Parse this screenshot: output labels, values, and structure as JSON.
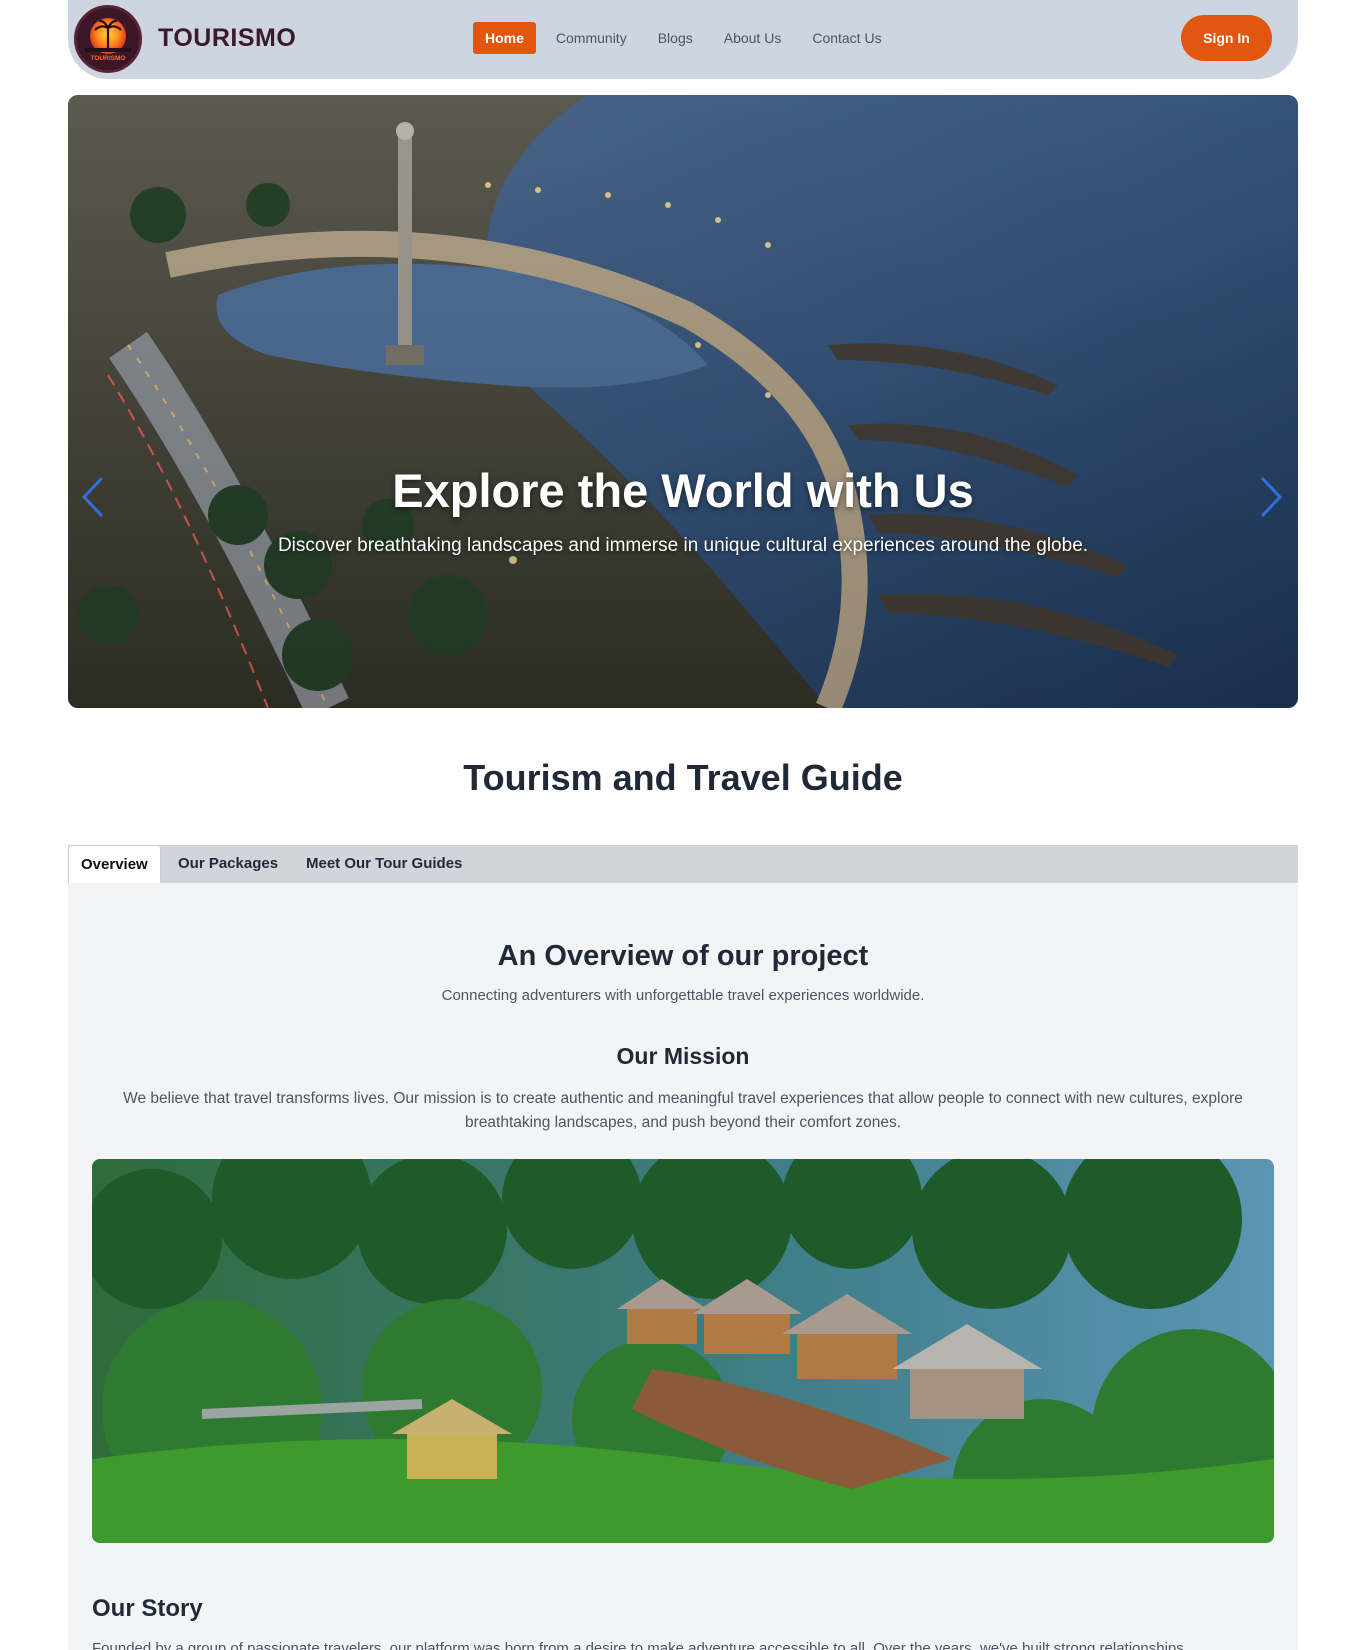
{
  "nav": {
    "brand": "TOURISMO",
    "logo_text": "TOURISMO",
    "links": [
      "Home",
      "Community",
      "Blogs",
      "About Us",
      "Contact Us"
    ],
    "active_index": 0,
    "sign_in": "Sign In"
  },
  "hero": {
    "title": "Explore the World with Us",
    "subtitle": "Discover breathtaking landscapes and immerse in unique cultural experiences around the globe.",
    "prev_icon": "chevron-left-icon",
    "next_icon": "chevron-right-icon"
  },
  "page_title": "Tourism and Travel Guide",
  "tabs": [
    "Overview",
    "Our Packages",
    "Meet Our Tour Guides"
  ],
  "overview": {
    "title": "An Overview of our project",
    "subtitle": "Connecting adventurers with unforgettable travel experiences worldwide.",
    "mission_title": "Our Mission",
    "mission_text": "We believe that travel transforms lives. Our mission is to create authentic and meaningful travel experiences that allow people to connect with new cultures, explore breathtaking landscapes, and push beyond their comfort zones.",
    "story_title": "Our Story",
    "story_text": "Founded by a group of passionate travelers, our platform was born from a desire to make adventure accessible to all. Over the years, we've built strong relationships"
  },
  "colors": {
    "accent": "#e2570f",
    "navbar_bg": "#cdd5e1",
    "tabbar_bg": "#d1d5db",
    "content_bg": "#f3f4f6",
    "carousel_arrow": "#2f6fe0"
  }
}
